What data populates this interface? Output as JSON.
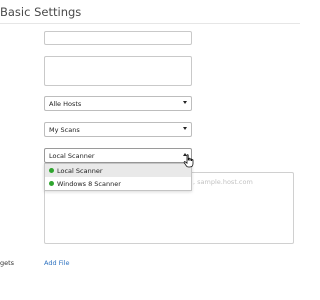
{
  "header": {
    "title": "Basic Settings"
  },
  "form": {
    "policy_select": {
      "value": "Alle Hosts"
    },
    "folder_select": {
      "value": "My Scans"
    },
    "scanner_select": {
      "value": "Local Scanner",
      "options": [
        {
          "label": "Local Scanner",
          "status_color": "#2fa52f",
          "selected": true
        },
        {
          "label": "Windows 8 Scanner",
          "status_color": "#2fa52f",
          "selected": false
        }
      ]
    },
    "targets": {
      "label": "gets",
      "placeholder": ", sample.host.com",
      "add_file_label": "Add File"
    }
  }
}
